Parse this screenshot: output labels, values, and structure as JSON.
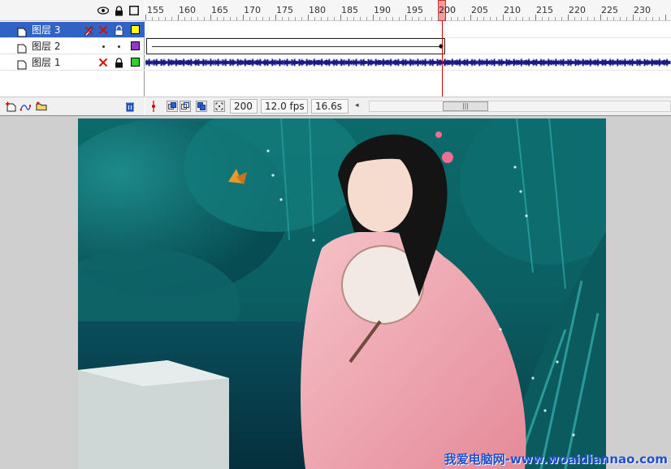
{
  "timeline": {
    "ruler_labels": [
      "155",
      "160",
      "165",
      "170",
      "175",
      "180",
      "185",
      "190",
      "195",
      "200",
      "205",
      "210",
      "215",
      "220",
      "225",
      "230"
    ],
    "current_frame_label": "200",
    "layers": [
      {
        "name": "图层 3",
        "selected": true,
        "color": "#ffff00",
        "visible": false,
        "locked": true,
        "outline_icon": "pencil-x-icon"
      },
      {
        "name": "图层 2",
        "selected": false,
        "color": "#9933cc",
        "visible": true,
        "locked": false
      },
      {
        "name": "图层 1",
        "selected": false,
        "color": "#33cc33",
        "visible": false,
        "locked": true
      }
    ],
    "status": {
      "frame": "200",
      "fps": "12.0 fps",
      "elapsed": "16.6s"
    },
    "footer_icons": [
      "insert-layer-icon",
      "add-motion-guide-icon",
      "insert-folder-icon",
      "delete-layer-icon"
    ],
    "frame_tool_icons": [
      "onion-skin-icon",
      "onion-outline-icon",
      "edit-multiple-frames-icon",
      "onion-markers-icon",
      "center-frame-icon"
    ]
  },
  "stage": {
    "image_description_icon": "stage-photo",
    "watermark": "我爱电脑网-www.woaidiannao.com"
  },
  "colors": {
    "selection": "#3163c6",
    "playhead": "#cc0000",
    "waveform": "#1a1a80"
  }
}
